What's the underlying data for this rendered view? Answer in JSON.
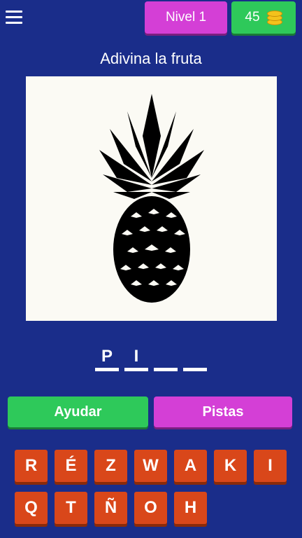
{
  "header": {
    "level_label": "Nivel 1",
    "coins": "45"
  },
  "question": {
    "title": "Adivina la fruta",
    "image_subject": "pineapple-silhouette"
  },
  "answer": {
    "slots": [
      "P",
      "I",
      "",
      ""
    ]
  },
  "actions": {
    "help_label": "Ayudar",
    "hints_label": "Pistas"
  },
  "keyboard": {
    "keys": [
      "R",
      "É",
      "Z",
      "W",
      "A",
      "K",
      "I",
      "Q",
      "T",
      "Ñ",
      "O",
      "H"
    ]
  },
  "colors": {
    "background": "#1a2d8a",
    "green": "#2ec95a",
    "magenta": "#d43fd6",
    "key": "#d9471a"
  }
}
